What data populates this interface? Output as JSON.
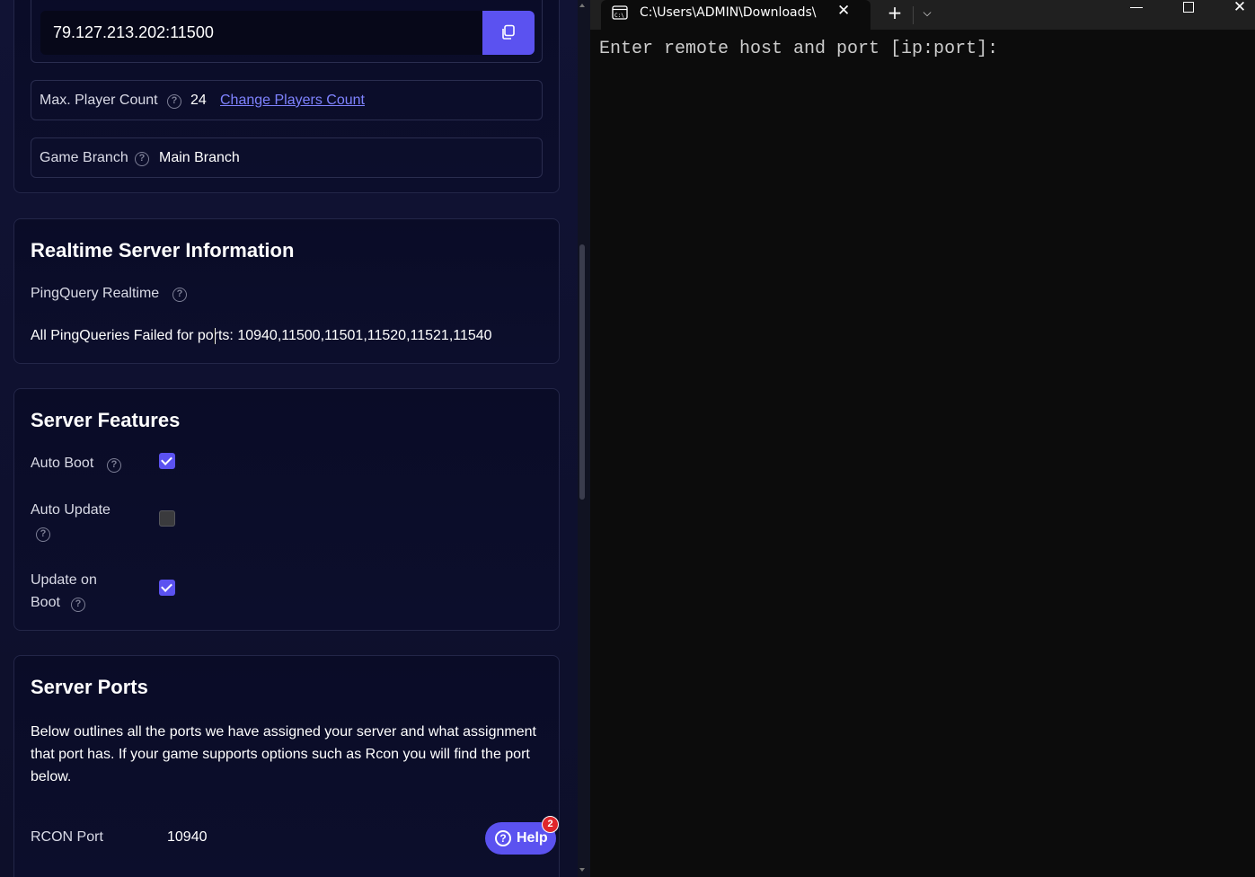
{
  "server_details": {
    "address": "79.127.213.202:11500",
    "max_player_label": "Max. Player Count",
    "max_player_value": "24",
    "change_players_link": "Change Players Count",
    "game_branch_label": "Game Branch",
    "game_branch_value": "Main Branch"
  },
  "realtime": {
    "title": "Realtime Server Information",
    "pingquery_label": "PingQuery Realtime",
    "status_text": "All PingQueries Failed for ports: 10940,11500,11501,11520,11521,11540"
  },
  "features": {
    "title": "Server Features",
    "items": [
      {
        "label": "Auto Boot",
        "checked": true
      },
      {
        "label": "Auto Update",
        "checked": false
      },
      {
        "label_line1": "Update on",
        "label_line2": "Boot",
        "checked": true
      }
    ]
  },
  "ports": {
    "title": "Server Ports",
    "description": "Below outlines all the ports we have assigned your server and what assignment that port has. If your game supports options such as Rcon you will find the port below.",
    "rows": [
      {
        "label": "RCON Port",
        "value": "10940"
      }
    ]
  },
  "help_button": {
    "label": "Help",
    "badge": "2"
  },
  "terminal": {
    "tab_title": "C:\\Users\\ADMIN\\Downloads\\",
    "prompt": "Enter remote host and port [ip:port]:"
  },
  "colors": {
    "accent": "#5b52f0",
    "link": "#7f83ff",
    "badge": "#e0262b",
    "panel_bg": "#0f1130",
    "terminal_bg": "#0c0c0c"
  }
}
